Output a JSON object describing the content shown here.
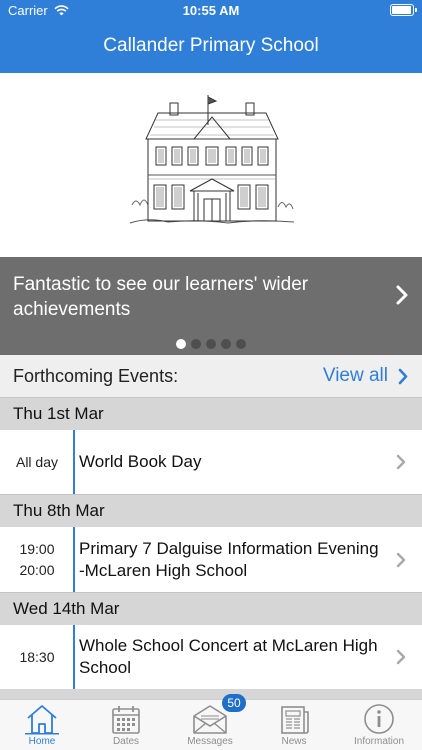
{
  "status_bar": {
    "carrier": "Carrier",
    "time": "10:55 AM",
    "battery_level": 1.0
  },
  "header": {
    "title": "Callander Primary School"
  },
  "carousel": {
    "text": "Fantastic to see our learners' wider achievements",
    "dot_count": 5,
    "active_dot": 0
  },
  "events_header": {
    "title": "Forthcoming Events:",
    "view_all_label": "View all"
  },
  "days": [
    {
      "date": "Thu 1st Mar",
      "events": [
        {
          "time_lines": [
            "All day"
          ],
          "title": "World Book Day"
        }
      ]
    },
    {
      "date": "Thu 8th Mar",
      "events": [
        {
          "time_lines": [
            "19:00",
            "20:00"
          ],
          "title": "Primary 7 Dalguise Information Evening -McLaren High School"
        }
      ]
    },
    {
      "date": "Wed 14th Mar",
      "events": [
        {
          "time_lines": [
            "18:30"
          ],
          "title": "Whole School Concert at McLaren High School"
        }
      ]
    }
  ],
  "tabbar": {
    "items": [
      {
        "label": "Home",
        "icon": "home-icon",
        "active": true
      },
      {
        "label": "Dates",
        "icon": "calendar-icon",
        "active": false
      },
      {
        "label": "Messages",
        "icon": "envelope-icon",
        "active": false,
        "badge": "50"
      },
      {
        "label": "News",
        "icon": "newspaper-icon",
        "active": false
      },
      {
        "label": "Information",
        "icon": "info-icon",
        "active": false
      }
    ]
  },
  "colors": {
    "brand_blue": "#2f7ed8",
    "carousel_grey": "#6e6e6e",
    "date_header_grey": "#d6d6d6"
  }
}
